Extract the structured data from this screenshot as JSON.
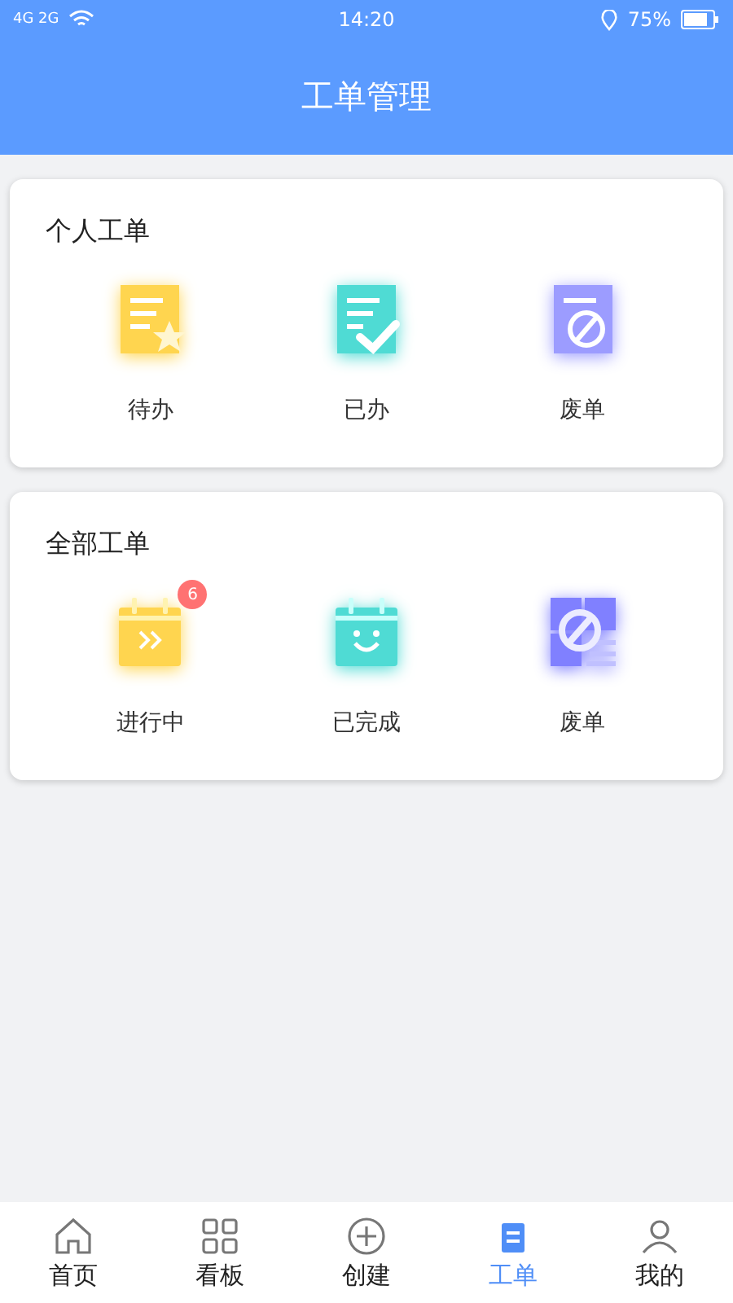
{
  "status_bar": {
    "network": "4G 2G",
    "time": "14:20",
    "battery": "75%"
  },
  "header": {
    "title": "工单管理"
  },
  "sections": [
    {
      "title": "个人工单",
      "items": [
        {
          "label": "待办",
          "kind": "note-star",
          "color": "#ffd54f"
        },
        {
          "label": "已办",
          "kind": "note-check",
          "color": "#4fdbd4"
        },
        {
          "label": "废单",
          "kind": "note-void",
          "color": "#9c9cff"
        }
      ]
    },
    {
      "title": "全部工单",
      "items": [
        {
          "label": "进行中",
          "kind": "calendar-forward",
          "color": "#ffd54f",
          "badge": "6"
        },
        {
          "label": "已完成",
          "kind": "calendar-smile",
          "color": "#4fdbd4"
        },
        {
          "label": "废单",
          "kind": "grid-void",
          "color": "#8080ff"
        }
      ]
    }
  ],
  "tabs": [
    {
      "label": "首页",
      "kind": "home",
      "selected": false
    },
    {
      "label": "看板",
      "kind": "grid",
      "selected": false
    },
    {
      "label": "创建",
      "kind": "plus",
      "selected": false
    },
    {
      "label": "工单",
      "kind": "clipboard",
      "selected": true
    },
    {
      "label": "我的",
      "kind": "user",
      "selected": false
    }
  ]
}
